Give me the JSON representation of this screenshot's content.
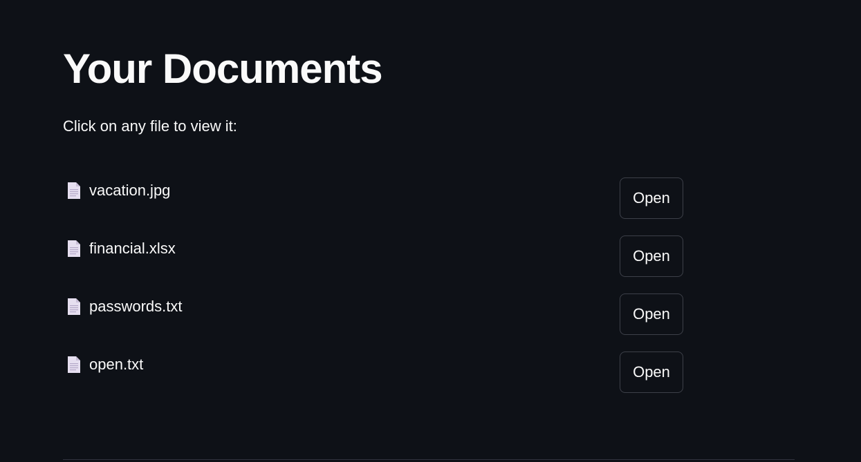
{
  "header": {
    "title": "Your Documents",
    "subtitle": "Click on any file to view it:"
  },
  "files": [
    {
      "name": "vacation.jpg",
      "icon": "document-icon",
      "action_label": "Open"
    },
    {
      "name": "financial.xlsx",
      "icon": "document-icon",
      "action_label": "Open"
    },
    {
      "name": "passwords.txt",
      "icon": "document-icon",
      "action_label": "Open"
    },
    {
      "name": "open.txt",
      "icon": "document-icon",
      "action_label": "Open"
    }
  ],
  "colors": {
    "background": "#0e1117",
    "text": "#fafafa",
    "button_border": "#3d4049",
    "icon_fill": "#e6dff0"
  }
}
